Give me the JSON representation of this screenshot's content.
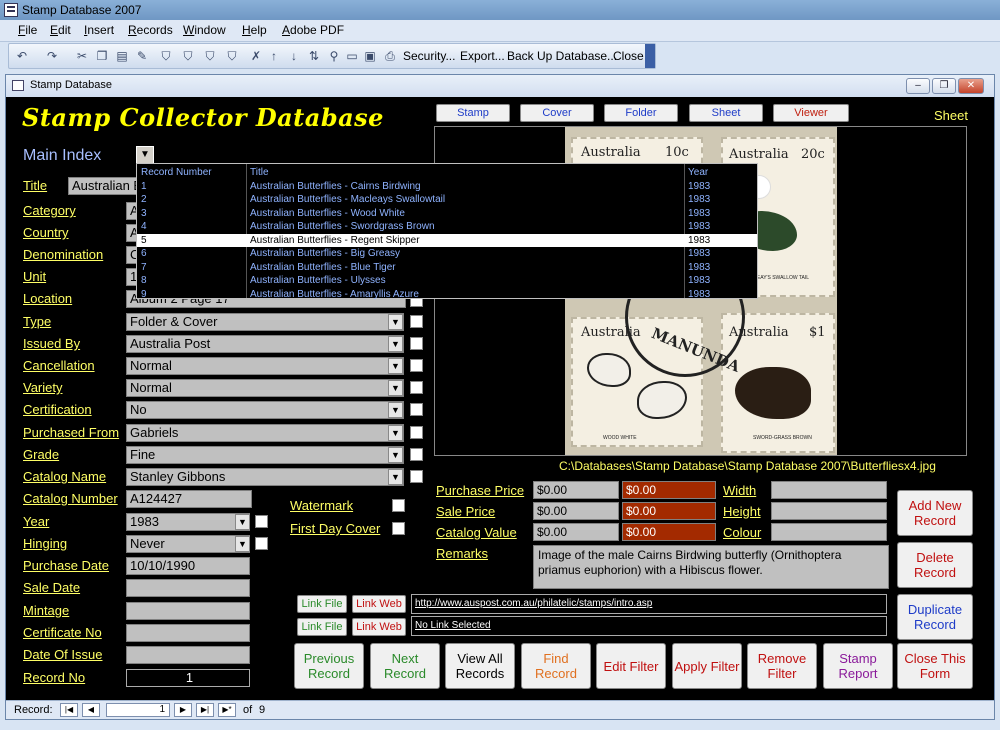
{
  "app": {
    "title": "Stamp Database 2007",
    "menus": [
      "File",
      "Edit",
      "Insert",
      "Records",
      "Window",
      "Help",
      "Adobe PDF"
    ],
    "toolbar_text": [
      "Security...",
      "Export...",
      "Back Up Database...",
      "Close"
    ]
  },
  "form": {
    "window_title": "Stamp Database",
    "brand_title": "Stamp Collector Database",
    "main_index_label": "Main Index",
    "dropdown": {
      "headers": [
        "Record Number",
        "Title",
        "Year"
      ],
      "rows": [
        {
          "num": "1",
          "title": "Australian Butterflies - Cairns Birdwing",
          "year": "1983"
        },
        {
          "num": "2",
          "title": "Australian Butterflies - Macleays Swallowtail",
          "year": "1983"
        },
        {
          "num": "3",
          "title": "Australian Butterflies - Wood White",
          "year": "1983"
        },
        {
          "num": "4",
          "title": "Australian Butterflies - Swordgrass Brown",
          "year": "1983"
        },
        {
          "num": "5",
          "title": "Australian Butterflies - Regent Skipper",
          "year": "1983"
        },
        {
          "num": "6",
          "title": "Australian Butterflies - Big Greasy",
          "year": "1983"
        },
        {
          "num": "7",
          "title": "Australian Butterflies - Blue Tiger",
          "year": "1983"
        },
        {
          "num": "8",
          "title": "Australian Butterflies - Ulysses",
          "year": "1983"
        },
        {
          "num": "9",
          "title": "Australian Butterflies - Amaryllis Azure",
          "year": "1983"
        }
      ],
      "selected_index": 4
    },
    "fields": {
      "title": {
        "label": "Title",
        "value": "Australian B"
      },
      "category": {
        "label": "Category",
        "value": "A"
      },
      "country": {
        "label": "Country",
        "value": "A"
      },
      "denomination": {
        "label": "Denomination",
        "value": "C"
      },
      "unit": {
        "label": "Unit",
        "value": "1"
      },
      "location": {
        "label": "Location",
        "value": "Album 2 Page 17"
      },
      "type": {
        "label": "Type",
        "value": "Folder & Cover"
      },
      "issued_by": {
        "label": "Issued By",
        "value": "Australia Post"
      },
      "cancellation": {
        "label": "Cancellation",
        "value": "Normal"
      },
      "variety": {
        "label": "Variety",
        "value": "Normal"
      },
      "certification": {
        "label": "Certification",
        "value": "No"
      },
      "purchased_from": {
        "label": "Purchased From",
        "value": "Gabriels"
      },
      "grade": {
        "label": "Grade",
        "value": "Fine"
      },
      "catalog_name": {
        "label": "Catalog Name",
        "value": "Stanley Gibbons"
      },
      "catalog_number": {
        "label": "Catalog Number",
        "value": "A124427"
      },
      "year": {
        "label": "Year",
        "value": "1983"
      },
      "hinging": {
        "label": "Hinging",
        "value": "Never"
      },
      "purchase_date": {
        "label": "Purchase Date",
        "value": "10/10/1990"
      },
      "sale_date": {
        "label": "Sale Date",
        "value": ""
      },
      "mintage": {
        "label": "Mintage",
        "value": ""
      },
      "certificate_no": {
        "label": "Certificate No",
        "value": ""
      },
      "date_of_issue": {
        "label": "Date Of Issue",
        "value": ""
      },
      "record_no": {
        "label": "Record No",
        "value": "1"
      }
    },
    "watermark_label": "Watermark",
    "first_day_cover_label": "First Day Cover",
    "view_tabs": [
      "Stamp",
      "Cover",
      "Folder",
      "Sheet",
      "Viewer"
    ],
    "view_mode_label": "Sheet",
    "image": {
      "country": "Australia",
      "values": [
        "10c",
        "20c",
        "$1"
      ],
      "captions": [
        "WOOD WHITE",
        "SWORD-GRASS BROWN",
        "MACLEAY'S SWALLOW TAIL"
      ],
      "postmark": "MANUNDA",
      "path": "C:\\Databases\\Stamp Database\\Stamp Database 2007\\Butterfliesx4.jpg"
    },
    "prices": {
      "purchase_price": {
        "label": "Purchase Price",
        "value": "$0.00",
        "alt": "$0.00"
      },
      "sale_price": {
        "label": "Sale Price",
        "value": "$0.00",
        "alt": "$0.00"
      },
      "catalog_value": {
        "label": "Catalog Value",
        "value": "$0.00",
        "alt": "$0.00"
      }
    },
    "dimensions": {
      "width_label": "Width",
      "height_label": "Height",
      "colour_label": "Colour"
    },
    "remarks_label": "Remarks",
    "remarks": "Image of the male Cairns Birdwing butterfly (Ornithoptera priamus euphorion) with a Hibiscus flower.",
    "links": {
      "link_file": "Link File",
      "link_web": "Link Web",
      "url": "http://www.auspost.com.au/philatelic/stamps/intro.asp",
      "no_link": "No Link Selected"
    },
    "side_buttons": [
      "Add New Record",
      "Delete Record",
      "Duplicate Record"
    ],
    "bottom_buttons": [
      {
        "label": "Previous\nRecord",
        "color": "#2a8a2a"
      },
      {
        "label": "Next\nRecord",
        "color": "#2a8a2a"
      },
      {
        "label": "View All\nRecords",
        "color": "#000000"
      },
      {
        "label": "Find\nRecord",
        "color": "#e07020"
      },
      {
        "label": "Edit Filter",
        "color": "#c01010"
      },
      {
        "label": "Apply Filter",
        "color": "#c01010"
      },
      {
        "label": "Remove\nFilter",
        "color": "#c01010"
      },
      {
        "label": "Stamp\nReport",
        "color": "#8a1a9a"
      },
      {
        "label": "Close This\nForm",
        "color": "#c01010"
      }
    ],
    "record_nav": {
      "label": "Record:",
      "current": "1",
      "of_label": "of",
      "total": "9"
    }
  }
}
